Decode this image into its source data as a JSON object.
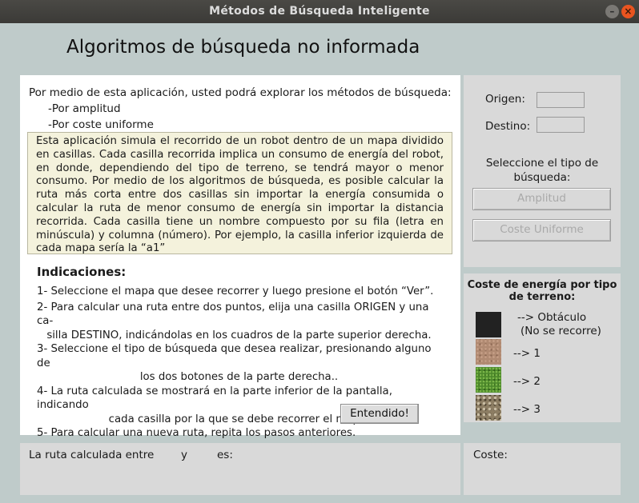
{
  "window": {
    "title": "Métodos de Búsqueda Inteligente",
    "minimize_glyph": "–",
    "close_glyph": "×"
  },
  "header": {
    "title": "Algoritmos de búsqueda no informada"
  },
  "intro": {
    "line1": "Por medio de esta aplicación, usted podrá explorar los métodos de búsqueda:",
    "item1": "-Por amplitud",
    "item2": "-Por coste uniforme"
  },
  "description": "Esta aplicación simula el recorrido de un robot dentro de un mapa dividido en casillas.  Cada casilla recorrida implica un consumo de energía del robot, en donde, dependiendo del tipo de terreno, se tendrá mayor o menor consumo. Por medio de los algoritmos de búsqueda, es posible calcular la ruta más corta entre dos casillas sin importar la energía consumida o calcular la ruta de menor consumo de energía sin importar la distancia recorrida.  Cada casilla tiene un nombre compuesto por su fila (letra en minúscula) y columna (número). Por ejemplo, la casilla inferior izquierda de cada mapa sería la “a1”",
  "instructions": {
    "title": "Indicaciones:",
    "steps": [
      {
        "main": "1- Seleccione el mapa que desee recorrer y luego presione el botón “Ver”.",
        "cont": ""
      },
      {
        "main": "2- Para calcular una ruta entre dos puntos, elija una casilla ORIGEN y una ca-",
        "cont": "silla  DESTINO, indicándolas en los cuadros de la parte superior derecha."
      },
      {
        "main": "3- Seleccione el tipo de búsqueda que desea realizar, presionando alguno de",
        "cont": "los dos   botones de  la parte derecha.."
      },
      {
        "main": "4- La ruta calculada se mostrará en la parte inferior de la pantalla, indicando",
        "cont": "cada casilla por la que se debe recorrer el mapa."
      },
      {
        "main": "5- Para calcular una nueva ruta, repita los pasos anteriores.",
        "cont": ""
      }
    ],
    "button_label": "Entendido!"
  },
  "controls": {
    "origen_label": "Origen:",
    "origen_value": "",
    "destino_label": "Destino:",
    "destino_value": "",
    "select_text": "Seleccione el tipo de búsqueda:",
    "btn_amplitud": "Amplitud",
    "btn_coste": "Coste Uniforme"
  },
  "terrain": {
    "title": "Coste de energía por tipo de terreno:",
    "obstacle": "--> Obtáculo",
    "obstacle_note": "(No se recorre)",
    "cost1": "--> 1",
    "cost2": "--> 2",
    "cost3": "--> 3"
  },
  "result": {
    "route_prefix": "La ruta calculada entre",
    "route_and": "y",
    "route_es": "es:",
    "coste_label": "Coste:"
  }
}
